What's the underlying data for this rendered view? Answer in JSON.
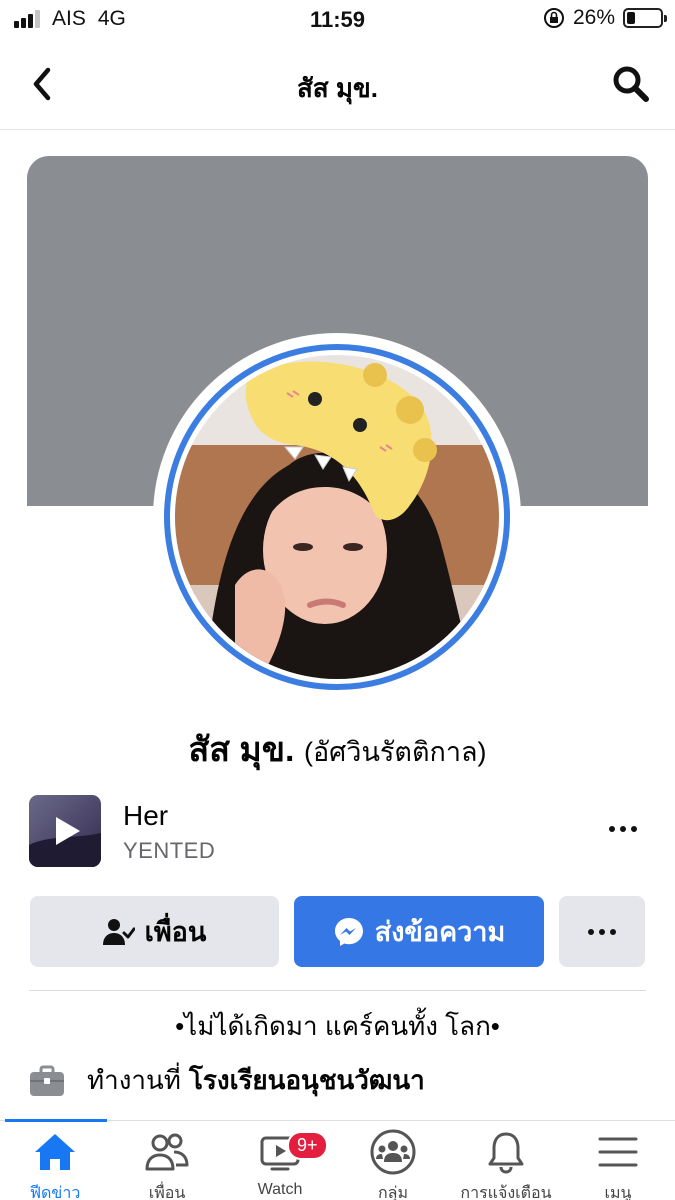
{
  "status_bar": {
    "carrier": "AIS",
    "network": "4G",
    "time": "11:59",
    "battery": "26%",
    "battery_level": 0.26
  },
  "header": {
    "title": "สัส มุข."
  },
  "profile": {
    "name": "สัส มุข.",
    "alternate_name": "(อัศวินรัตติกาล)"
  },
  "music": {
    "title": "Her",
    "artist": "YENTED"
  },
  "actions": {
    "friends_label": "เพื่อน",
    "message_label": "ส่งข้อความ"
  },
  "bio": "•ไม่ได้เกิดมา แคร์คนทั้ง โลก•",
  "work": {
    "prefix": "ทำงานที่",
    "place": "โรงเรียนอนุชนวัฒนา"
  },
  "bottom_nav": {
    "items": [
      {
        "label": "ฟีดข่าว",
        "icon": "home-icon",
        "active": true
      },
      {
        "label": "เพื่อน",
        "icon": "friends-icon"
      },
      {
        "label": "Watch",
        "icon": "watch-icon",
        "badge": "9+"
      },
      {
        "label": "กลุ่ม",
        "icon": "groups-icon"
      },
      {
        "label": "การแจ้งเตือน",
        "icon": "bell-icon"
      },
      {
        "label": "เมนู",
        "icon": "menu-icon"
      }
    ]
  },
  "colors": {
    "accent": "#1877f2",
    "message_button": "#3578e5",
    "cover": "#8a8d91",
    "badge": "#e41e3f"
  }
}
